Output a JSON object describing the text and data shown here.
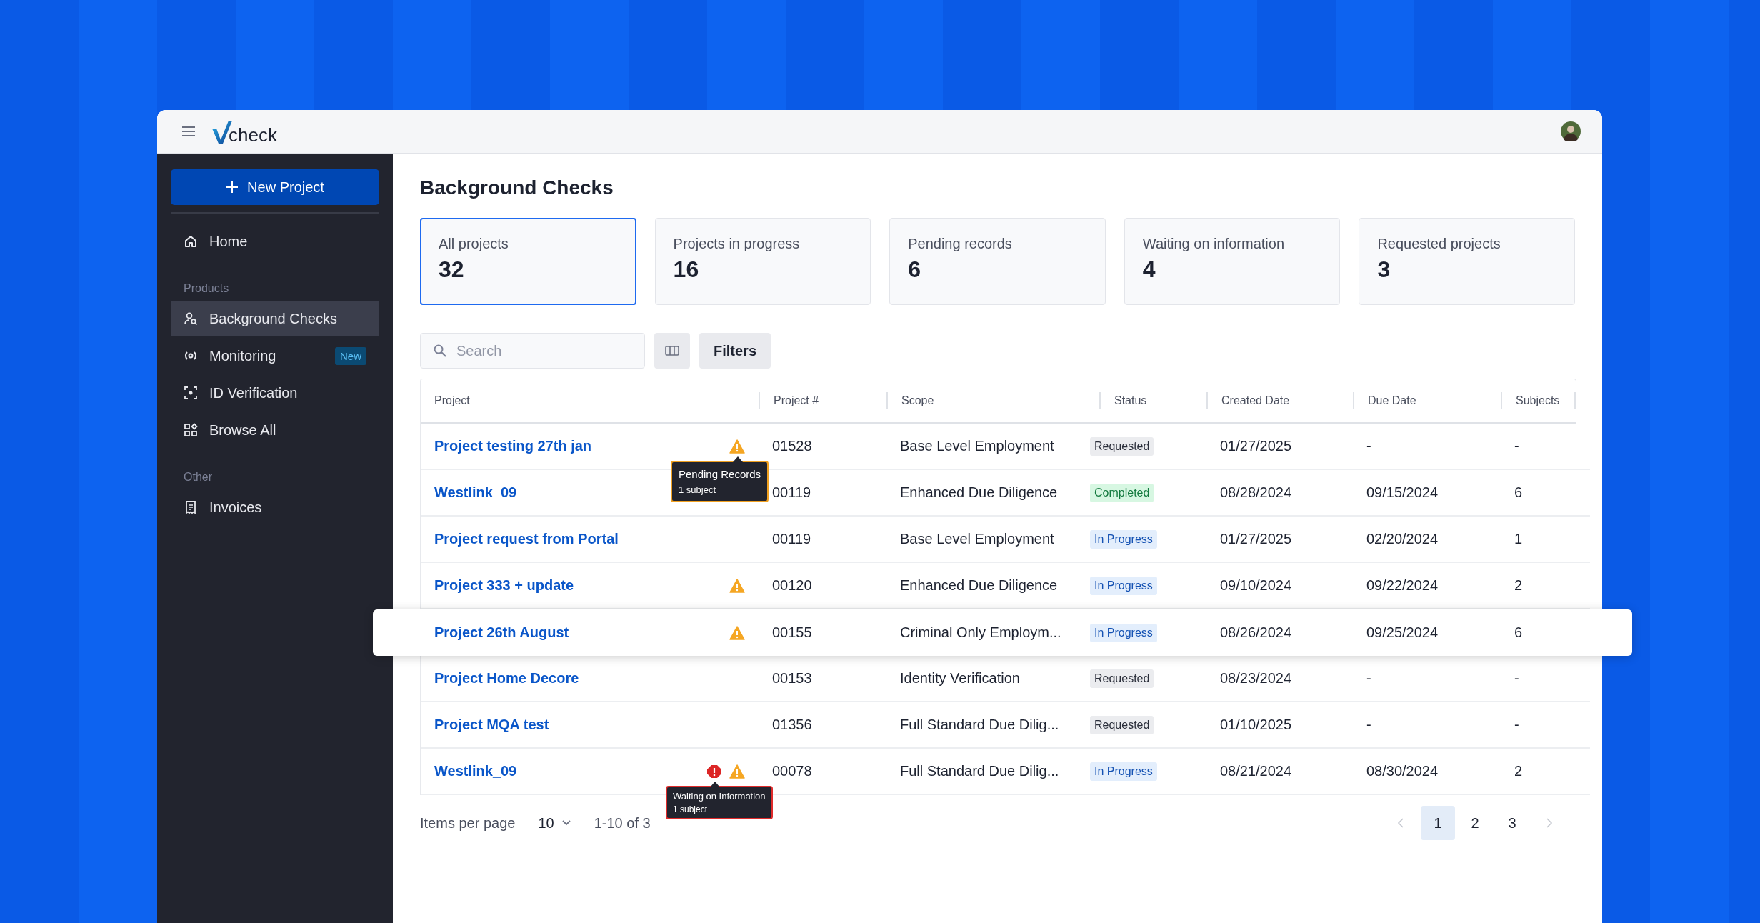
{
  "header": {
    "logo_text": "check"
  },
  "sidebar": {
    "new_button": "New Project",
    "top_items": [
      {
        "label": "Home",
        "selected": false
      }
    ],
    "sections": [
      {
        "title": "Products",
        "items": [
          {
            "label": "Background Checks",
            "selected": true
          },
          {
            "label": "Monitoring",
            "selected": false,
            "badge": "New"
          },
          {
            "label": "ID Verification",
            "selected": false
          },
          {
            "label": "Browse All",
            "selected": false
          }
        ]
      },
      {
        "title": "Other",
        "items": [
          {
            "label": "Invoices",
            "selected": false
          }
        ]
      }
    ]
  },
  "page_title": "Background Checks",
  "stat_cards": [
    {
      "label": "All projects",
      "value": "32",
      "selected": true
    },
    {
      "label": "Projects in progress",
      "value": "16",
      "selected": false
    },
    {
      "label": "Pending records",
      "value": "6",
      "selected": false
    },
    {
      "label": "Waiting on information",
      "value": "4",
      "selected": false
    },
    {
      "label": "Requested projects",
      "value": "3",
      "selected": false
    }
  ],
  "toolbar": {
    "search": {
      "placeholder": "Search"
    },
    "filters_button": "Filters"
  },
  "table": {
    "columns": [
      "Project",
      "Project #",
      "Scope",
      "Status",
      "Created Date",
      "Due Date",
      "Subjects"
    ],
    "rows": [
      {
        "project": "Project testing 27th jan",
        "flags": [
          {
            "kind": "warning",
            "tooltip": {
              "title": "Pending Records",
              "detail": "1 subject"
            }
          }
        ],
        "number": "01528",
        "scope": "Base Level Employment",
        "status": {
          "text": "Requested",
          "kind": "requested"
        },
        "created": "01/27/2025",
        "due": "-",
        "subjects": "-",
        "highlighted": false
      },
      {
        "project": "Westlink_09",
        "flags": [],
        "number": "00119",
        "scope": "Enhanced Due Diligence",
        "status": {
          "text": "Completed",
          "kind": "completed"
        },
        "created": "08/28/2024",
        "due": "09/15/2024",
        "subjects": "6",
        "highlighted": false
      },
      {
        "project": "Project request from Portal",
        "flags": [],
        "number": "00119",
        "scope": "Base Level Employment",
        "status": {
          "text": "In Progress",
          "kind": "in_progress"
        },
        "created": "01/27/2025",
        "due": "02/20/2024",
        "subjects": "1",
        "highlighted": false
      },
      {
        "project": "Project 333 + update",
        "flags": [
          {
            "kind": "warning"
          }
        ],
        "number": "00120",
        "scope": "Enhanced Due Diligence",
        "status": {
          "text": "In Progress",
          "kind": "in_progress"
        },
        "created": "09/10/2024",
        "due": "09/22/2024",
        "subjects": "2",
        "highlighted": false
      },
      {
        "project": "Project 26th August",
        "flags": [
          {
            "kind": "warning"
          }
        ],
        "number": "00155",
        "scope": "Criminal Only Employm...",
        "status": {
          "text": "In Progress",
          "kind": "in_progress"
        },
        "created": "08/26/2024",
        "due": "09/25/2024",
        "subjects": "6",
        "highlighted": true
      },
      {
        "project": "Project Home Decore",
        "flags": [],
        "number": "00153",
        "scope": "Identity Verification",
        "status": {
          "text": "Requested",
          "kind": "requested"
        },
        "created": "08/23/2024",
        "due": "-",
        "subjects": "-",
        "highlighted": false
      },
      {
        "project": "Project MQA test",
        "flags": [],
        "number": "01356",
        "scope": "Full Standard Due Dilig...",
        "status": {
          "text": "Requested",
          "kind": "requested"
        },
        "created": "01/10/2025",
        "due": "-",
        "subjects": "-",
        "highlighted": false
      },
      {
        "project": "Westlink_09",
        "flags": [
          {
            "kind": "error",
            "tooltip": {
              "title": "Waiting on Information",
              "detail": "1 subject"
            }
          },
          {
            "kind": "warning"
          }
        ],
        "number": "00078",
        "scope": "Full Standard Due Dilig...",
        "status": {
          "text": "In Progress",
          "kind": "in_progress"
        },
        "created": "08/21/2024",
        "due": "08/30/2024",
        "subjects": "2",
        "highlighted": false
      }
    ]
  },
  "pagination": {
    "items_label": "Items per page",
    "per_page": "10",
    "range": "1-10 of 3",
    "pages": [
      {
        "label": "1",
        "selected": true
      },
      {
        "label": "2",
        "selected": false
      },
      {
        "label": "3",
        "selected": false
      }
    ]
  }
}
